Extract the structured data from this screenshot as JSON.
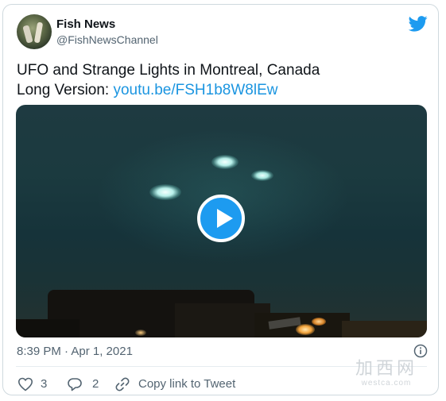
{
  "tweet": {
    "author_name": "Fish News",
    "author_handle": "@FishNewsChannel",
    "text_line1": "UFO and Strange Lights in Montreal, Canada",
    "text_line2_prefix": "Long Version: ",
    "link_text": "youtu.be/FSH1b8W8lEw",
    "timestamp": "8:39 PM · Apr 1, 2021"
  },
  "actions": {
    "like_count": "3",
    "reply_count": "2",
    "copy_link_label": "Copy link to Tweet"
  },
  "watermark": {
    "text": "加西网",
    "url": "westca.com"
  },
  "colors": {
    "accent": "#1d9bf0",
    "link": "#1b95e0",
    "secondary_text": "#536471",
    "border": "#cfd9de"
  },
  "icons": [
    "twitter-bird-icon",
    "play-icon",
    "info-icon",
    "heart-icon",
    "reply-icon",
    "link-icon"
  ]
}
